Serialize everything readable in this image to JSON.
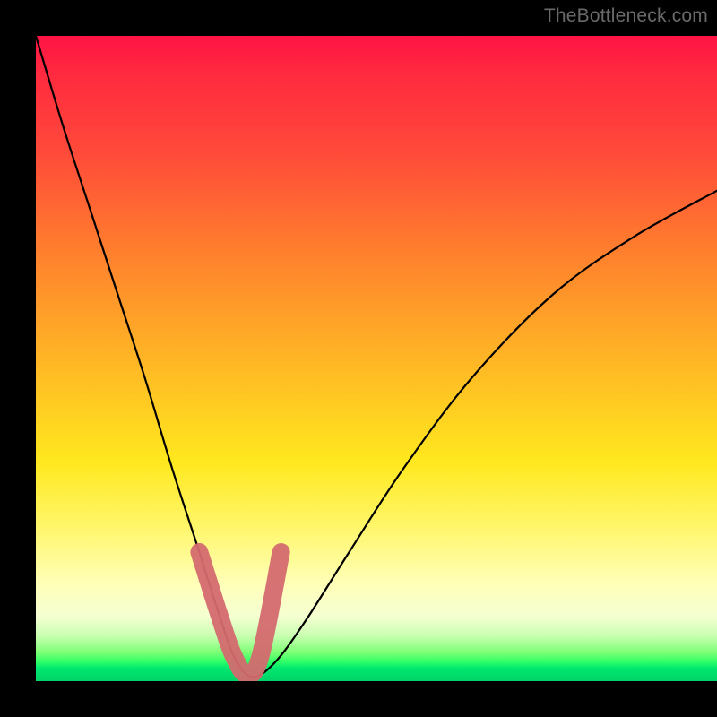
{
  "watermark": "TheBottleneck.com",
  "chart_data": {
    "type": "line",
    "title": "",
    "xlabel": "",
    "ylabel": "",
    "xlim": [
      0,
      100
    ],
    "ylim": [
      0,
      100
    ],
    "background_gradient": {
      "direction": "top-to-bottom",
      "stops": [
        {
          "pos": 0,
          "color": "#ff1445"
        },
        {
          "pos": 0.32,
          "color": "#ff7a2e"
        },
        {
          "pos": 0.56,
          "color": "#ffc822"
        },
        {
          "pos": 0.85,
          "color": "#ffffb8"
        },
        {
          "pos": 0.97,
          "color": "#2fff66"
        },
        {
          "pos": 1.0,
          "color": "#00d366"
        }
      ]
    },
    "series": [
      {
        "name": "bottleneck-curve",
        "x": [
          0,
          4,
          8,
          12,
          16,
          20,
          24,
          27,
          29,
          31,
          33,
          36,
          40,
          46,
          54,
          64,
          76,
          88,
          100
        ],
        "y": [
          100,
          86,
          73,
          60,
          47,
          33,
          20,
          10,
          4,
          1,
          1,
          4,
          10,
          20,
          33,
          47,
          60,
          69,
          76
        ]
      }
    ],
    "annotations": [
      {
        "name": "optimal-valley",
        "shape": "thick-stroke",
        "color": "#d46a6f",
        "x": [
          24,
          27,
          29,
          31,
          33,
          36
        ],
        "y": [
          20,
          10,
          4,
          1,
          4,
          20
        ]
      }
    ]
  }
}
